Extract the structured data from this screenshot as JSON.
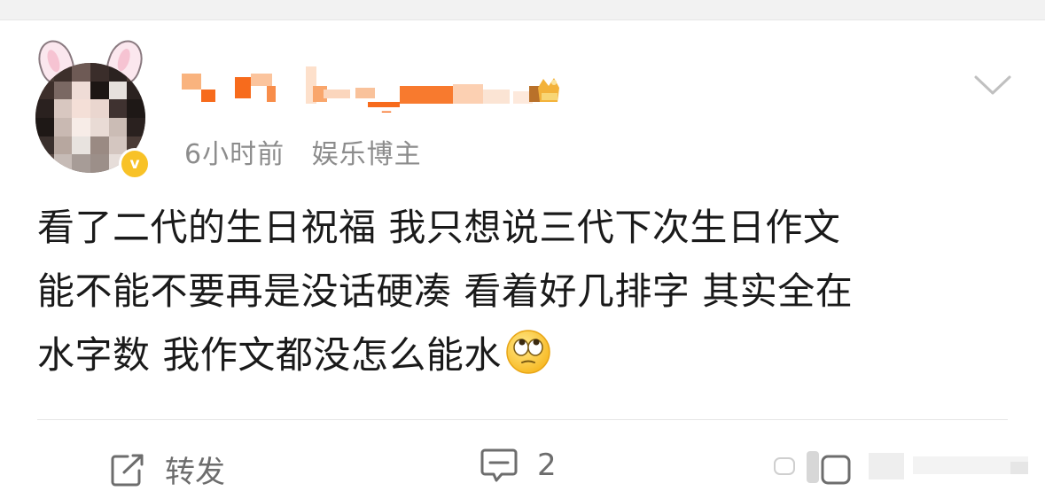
{
  "post": {
    "username": "_",
    "timestamp": "6小时前",
    "author_tag": "娱乐博主",
    "verified_badge": "v",
    "text_lines": [
      "看了二代的生日祝福 我只想说三代下次生日作文",
      "能不能不要再是没话硬凑 看着好几排字 其实全在",
      "水字数 我作文都没怎么能水"
    ],
    "emoji": "eye-roll-emoji"
  },
  "actions": {
    "repost_label": "转发",
    "comment_count": "2"
  },
  "icons": {
    "menu": "chevron-down-icon",
    "repost": "repost-icon",
    "comment": "comment-icon",
    "like": "like-icon",
    "crown": "crown-icon"
  },
  "colors": {
    "text": "#1a1a1a",
    "meta": "#8c8c8c",
    "badge": "#f8c227",
    "username_accent": "#f76b1c"
  }
}
